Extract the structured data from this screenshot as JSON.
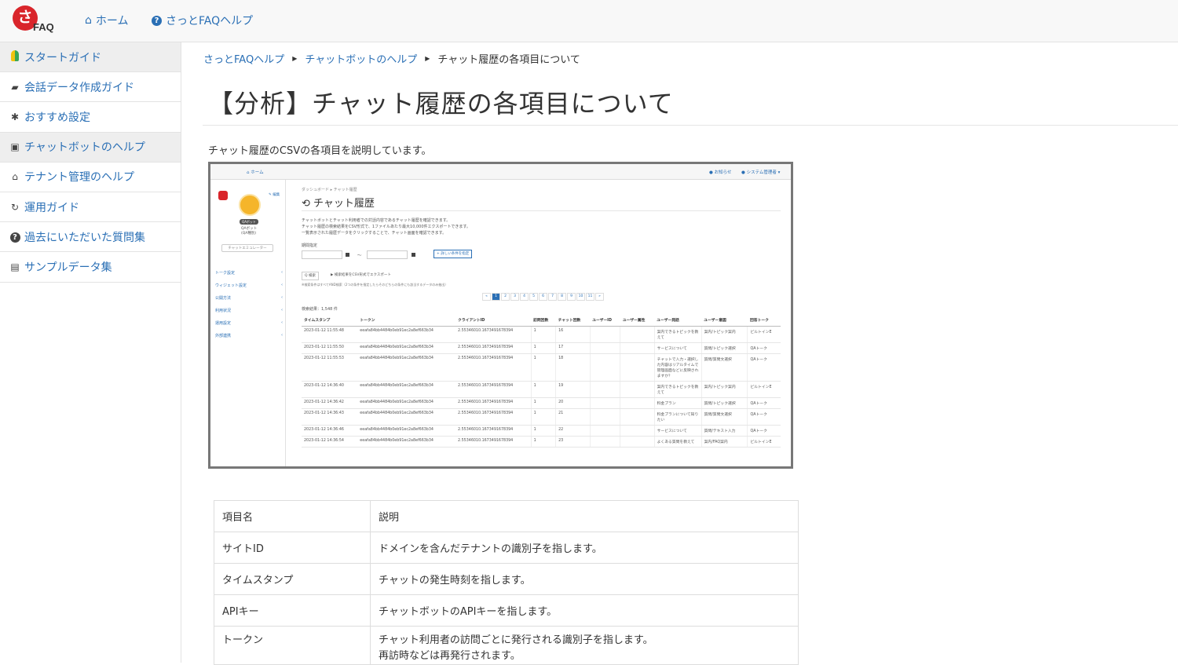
{
  "navbar": {
    "logo_mark": "さ",
    "logo_brand": "ͨFAQ",
    "home_label": "ホーム",
    "help_label": "さっとFAQヘルプ"
  },
  "sidebar": {
    "items": [
      {
        "label": "スタートガイド",
        "icon": "beginner-leaf-icon",
        "active": true
      },
      {
        "label": "会話データ作成ガイド",
        "icon": "comments-icon"
      },
      {
        "label": "おすすめ設定",
        "icon": "gear-icon"
      },
      {
        "label": "チャットボットのヘルプ",
        "icon": "robot-icon",
        "active": true
      },
      {
        "label": "テナント管理のヘルプ",
        "icon": "home-icon"
      },
      {
        "label": "運用ガイド",
        "icon": "refresh-icon"
      },
      {
        "label": "過去にいただいた質問集",
        "icon": "question-circle-icon"
      },
      {
        "label": "サンプルデータ集",
        "icon": "file-icon"
      }
    ]
  },
  "breadcrumb": {
    "items": [
      "さっとFAQヘルプ",
      "チャットボットのヘルプ",
      "チャット履歴の各項目について"
    ]
  },
  "page": {
    "title": "【分析】チャット履歴の各項目について",
    "intro": "チャット履歴のCSVの各項目を説明しています。"
  },
  "screenshot": {
    "nav_home": "ホーム",
    "nav_notice": "お知らせ",
    "nav_admin": "システム管理者",
    "edit_label": "編集",
    "badge": "QAボット",
    "bot_name": "QAボット",
    "bot_sub": "(QA種別)",
    "emulator": "チャットエミュレーター",
    "menu": [
      "トーク設定",
      "ウィジェット設定",
      "公開方法",
      "利用状況",
      "運用設定",
      "外部連携"
    ],
    "breadcrumb": "ダッシュボード ▸ チャット履歴",
    "title": "チャット履歴",
    "desc": [
      "チャットボットとチャット利用者での対話内容であるチャット履歴を確認できます。",
      "チャット履歴の検索結果をCSV形式で、1ファイルあたり最大10,000件エクスポートできます。",
      "一覧表示された履歴データをクリックすることで、チャット画面を確認できます。"
    ],
    "period_label": "期間指定",
    "tilde": "〜",
    "detail_button": "+ 詳しい条件を指定",
    "search_button": "Q 検索",
    "export_button": "検索結果をCSV形式でエクスポート",
    "note": "※検索条件はすべてAND検索（2つの条件を指定したらそのどちらの条件にも該当するデータのみ抽出）",
    "pages": [
      "«",
      "1",
      "2",
      "3",
      "4",
      "5",
      "6",
      "7",
      "8",
      "9",
      "10",
      "11",
      "»"
    ],
    "result_count": "検索結果：1,548 件",
    "columns": [
      "タイムスタンプ",
      "トークン",
      "クライアントID",
      "訪問回数",
      "チャット回数",
      "ユーザーID",
      "ユーザー属性",
      "ユーザー発話",
      "ユーザー意図",
      "回答トーク"
    ],
    "rows": [
      [
        "2023-01-12 11:55:48",
        "eeafa84bb4484b0eb91ec2a8ef663b34",
        "2.55346010.1673491678394",
        "1",
        "16",
        "",
        "",
        "案内できるトピックを教えて",
        "案内/トピック案内",
        "ビルトインE"
      ],
      [
        "2023-01-12 11:55:50",
        "eeafa84bb4484b0eb91ec2a8ef663b34",
        "2.55346010.1673491678394",
        "1",
        "17",
        "",
        "",
        "サービスについて",
        "質問/トピック選択",
        "QAトーク"
      ],
      [
        "2023-01-12 11:55:53",
        "eeafa84bb4484b0eb91ec2a8ef663b34",
        "2.55346010.1673491678394",
        "1",
        "18",
        "",
        "",
        "チャットで入力・選択した内容はリアルタイムで管理画面などに反映されますか？",
        "質問/質問文選択",
        "QAトーク"
      ],
      [
        "2023-01-12 14:36:40",
        "eeafa84bb4484b0eb91ec2a8ef663b34",
        "2.55346010.1673491678394",
        "1",
        "19",
        "",
        "",
        "案内できるトピックを教えて",
        "案内/トピック案内",
        "ビルトインE"
      ],
      [
        "2023-01-12 14:36:42",
        "eeafa84bb4484b0eb91ec2a8ef663b34",
        "2.55346010.1673491678394",
        "1",
        "20",
        "",
        "",
        "料金プラン",
        "質問/トピック選択",
        "QAトーク"
      ],
      [
        "2023-01-12 14:36:43",
        "eeafa84bb4484b0eb91ec2a8ef663b34",
        "2.55346010.1673491678394",
        "1",
        "21",
        "",
        "",
        "料金プランについて知りたい",
        "質問/質問文選択",
        "QAトーク"
      ],
      [
        "2023-01-12 14:36:46",
        "eeafa84bb4484b0eb91ec2a8ef663b34",
        "2.55346010.1673491678394",
        "1",
        "22",
        "",
        "",
        "サービスについて",
        "質問/テキスト入力",
        "QAトーク"
      ],
      [
        "2023-01-12 14:36:54",
        "eeafa84bb4484b0eb91ec2a8ef663b34",
        "2.55346010.1673491678394",
        "1",
        "23",
        "",
        "",
        "よくある質問を教えて",
        "案内/FAQ案内",
        "ビルトインE"
      ]
    ]
  },
  "desc_table": {
    "header": [
      "項目名",
      "説明"
    ],
    "rows": [
      [
        "サイトID",
        "ドメインを含んだテナントの識別子を指します。"
      ],
      [
        "タイムスタンプ",
        "チャットの発生時刻を指します。"
      ],
      [
        "APIキー",
        "チャットボットのAPIキーを指します。"
      ],
      [
        "トークン",
        "チャット利用者の訪問ごとに発行される識別子を指します。",
        "再訪時などは再発行されます。"
      ]
    ]
  }
}
